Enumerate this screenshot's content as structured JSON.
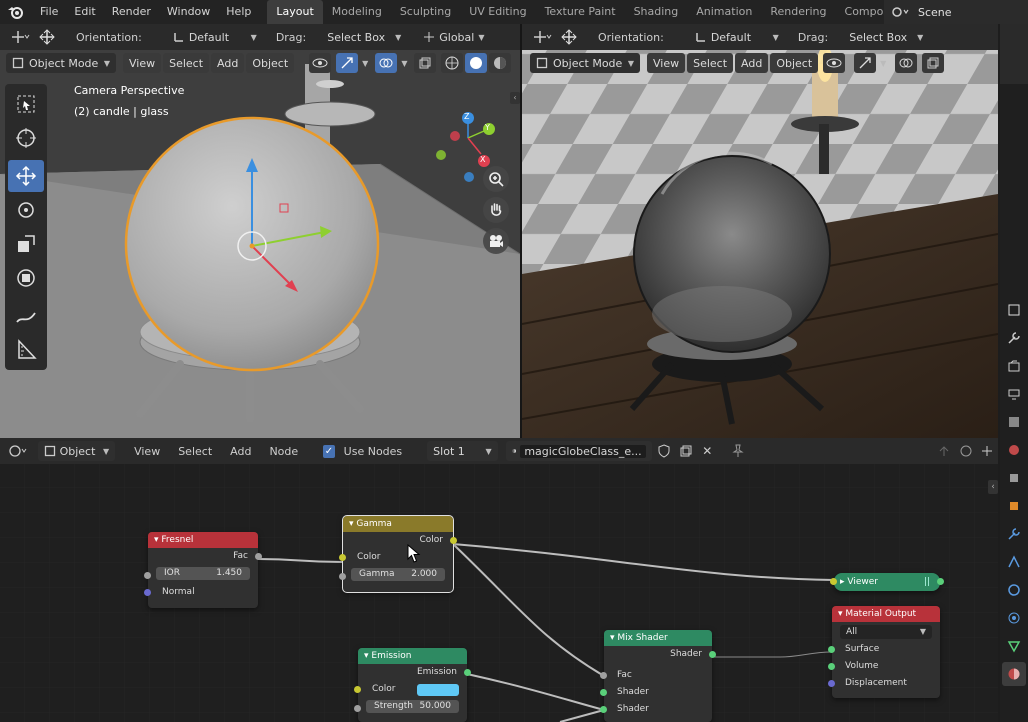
{
  "menu": [
    "File",
    "Edit",
    "Render",
    "Window",
    "Help"
  ],
  "workspaces": [
    "Layout",
    "Modeling",
    "Sculpting",
    "UV Editing",
    "Texture Paint",
    "Shading",
    "Animation",
    "Rendering",
    "Compositing"
  ],
  "active_workspace": "Layout",
  "scene": "Scene",
  "left_viewport": {
    "orientation_label": "Orientation:",
    "orientation_value": "Default",
    "drag_label": "Drag:",
    "drag_value": "Select Box",
    "transform_value": "Global",
    "mode": "Object Mode",
    "menus": [
      "View",
      "Select",
      "Add",
      "Object"
    ],
    "overlay_title": "Camera Perspective",
    "overlay_object": "(2) candle | glass",
    "gizmo_axes": {
      "x": "X",
      "y": "Y",
      "z": "Z"
    }
  },
  "right_viewport": {
    "orientation_label": "Orientation:",
    "orientation_value": "Default",
    "drag_label": "Drag:",
    "drag_value": "Select Box",
    "mode": "Object Mode",
    "menus": [
      "View",
      "Select",
      "Add",
      "Object"
    ]
  },
  "node_editor": {
    "type_value": "Object",
    "menus": [
      "View",
      "Select",
      "Add",
      "Node"
    ],
    "use_nodes_label": "Use Nodes",
    "slot_value": "Slot 1",
    "material_name": "magicGlobeClass_e...",
    "nodes": {
      "fresnel": {
        "title": "Fresnel",
        "out": "Fac",
        "ior_label": "IOR",
        "ior_value": "1.450",
        "normal": "Normal"
      },
      "gamma": {
        "title": "Gamma",
        "out": "Color",
        "in_color": "Color",
        "gamma_label": "Gamma",
        "gamma_value": "2.000"
      },
      "viewer": {
        "title": "Viewer"
      },
      "material_output": {
        "title": "Material Output",
        "target": "All",
        "surface": "Surface",
        "volume": "Volume",
        "displacement": "Displacement"
      },
      "mix_shader": {
        "title": "Mix Shader",
        "out": "Shader",
        "fac": "Fac",
        "shader1": "Shader",
        "shader2": "Shader"
      },
      "emission": {
        "title": "Emission",
        "out": "Emission",
        "color_label": "Color",
        "strength_label": "Strength",
        "strength_value": "50.000"
      }
    }
  },
  "colors": {
    "accent": "#4772b3",
    "fresnel_header": "#b8323a",
    "gamma_header": "#8a7a2a",
    "shader_header": "#2e8a62",
    "output_header": "#b8323a",
    "emission_swatch": "#5fc8f5",
    "selection_outline": "#f0a030"
  }
}
